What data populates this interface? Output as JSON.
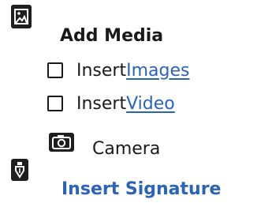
{
  "add_media": {
    "heading": "Add Media",
    "icon": "image-icon"
  },
  "options": [
    {
      "prefix": "Insert",
      "link": " Images",
      "checked": false
    },
    {
      "prefix": "Insert ",
      "link": "Video",
      "checked": false
    }
  ],
  "camera": {
    "label": "Camera",
    "icon": "camera-icon"
  },
  "signature": {
    "heading": "Insert Signature",
    "icon": "pen-nib-icon"
  },
  "colors": {
    "text": "#1a1a1a",
    "link": "#2a63b7",
    "icon": "#1f1f1f"
  }
}
